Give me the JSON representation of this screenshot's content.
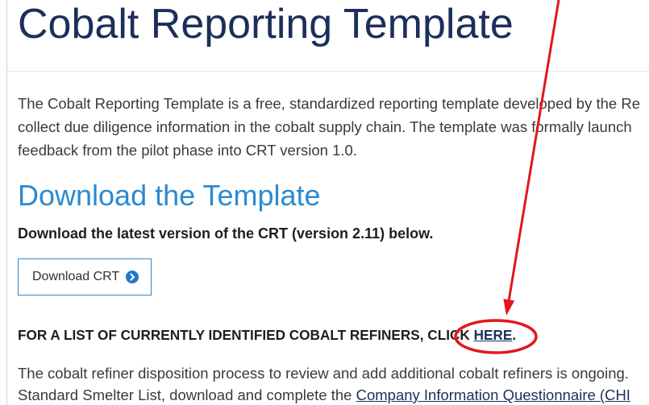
{
  "header": {
    "title": "Cobalt Reporting Template"
  },
  "intro": {
    "lines": [
      "The Cobalt Reporting Template is a free, standardized reporting template developed by the Re",
      "collect due diligence information in the cobalt supply chain. The template was formally launch",
      "feedback from the pilot phase into CRT version 1.0."
    ]
  },
  "download": {
    "heading": "Download the Template",
    "instruction": "Download the latest version of the CRT (version 2.11) below.",
    "button": {
      "label": "Download CRT",
      "icon": "chevron-right-circle-icon"
    }
  },
  "refiners": {
    "text": "FOR A LIST OF CURRENTLY IDENTIFIED COBALT REFINERS, CLICK ",
    "link": "HERE",
    "after": "."
  },
  "disposition": {
    "line1": "The cobalt refiner disposition process to review and add additional cobalt refiners is ongoing.",
    "line2_text": "Standard Smelter List, download and complete the ",
    "line2_link": "Company Information Questionnaire (CHI"
  },
  "theme": {
    "title_color": "#1c2e5a",
    "heading_color": "#2b8ad1",
    "link_color": "#1f2f5c",
    "button_border_color": "#2f86cc",
    "icon_color": "#1f7ac5",
    "annotation_color": "#e3171e"
  }
}
